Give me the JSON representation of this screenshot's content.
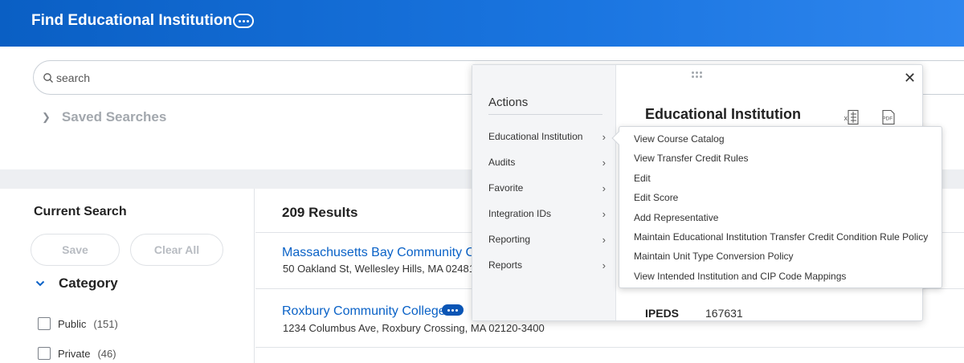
{
  "header": {
    "title": "Find Educational Institution"
  },
  "search": {
    "placeholder": "search"
  },
  "saved_searches": {
    "label": "Saved Searches"
  },
  "filters": {
    "title": "Current Search",
    "save_label": "Save",
    "clear_label": "Clear All",
    "category_label": "Category",
    "facets": [
      {
        "label": "Public",
        "count": "(151)"
      },
      {
        "label": "Private",
        "count": "(46)"
      }
    ]
  },
  "results": {
    "count_label": "209 Results",
    "items": [
      {
        "name": "Massachusetts Bay Community Co",
        "address": "50 Oakland St, Wellesley Hills, MA 02481-5"
      },
      {
        "name": "Roxbury Community College",
        "address": "1234 Columbus Ave, Roxbury Crossing, MA 02120-3400"
      }
    ]
  },
  "popup": {
    "actions_title": "Actions",
    "actions": [
      {
        "label": "Educational Institution"
      },
      {
        "label": "Audits"
      },
      {
        "label": "Favorite"
      },
      {
        "label": "Integration IDs"
      },
      {
        "label": "Reporting"
      },
      {
        "label": "Reports"
      }
    ],
    "detail_title": "Educational Institution",
    "excel_icon": "excel-export-icon",
    "pdf_icon": "pdf-export-icon",
    "ipeds": {
      "label": "IPEDS",
      "value": "167631"
    }
  },
  "submenu": {
    "items": [
      {
        "label": "View Course Catalog"
      },
      {
        "label": "View Transfer Credit Rules"
      },
      {
        "label": "Edit"
      },
      {
        "label": "Edit Score"
      },
      {
        "label": "Add Representative"
      },
      {
        "label": "Maintain Educational Institution Transfer Credit Condition Rule Policy"
      },
      {
        "label": "Maintain Unit Type Conversion Policy"
      },
      {
        "label": "View Intended Institution and CIP Code Mappings"
      }
    ]
  },
  "colors": {
    "brand": "#0a5fc4",
    "link": "#0a62c7"
  }
}
